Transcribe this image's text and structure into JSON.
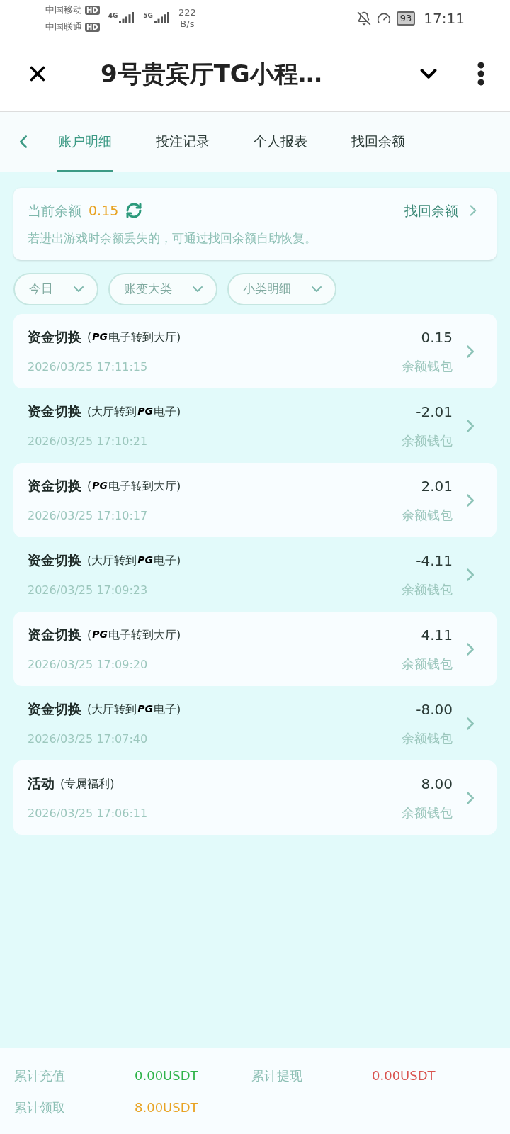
{
  "status_bar": {
    "carriers": [
      {
        "name": "中国移动",
        "badge": "HD"
      },
      {
        "name": "中国联通",
        "badge": "HD"
      }
    ],
    "networks": [
      "4G",
      "5G"
    ],
    "speed_value": "222",
    "speed_unit": "B/s",
    "battery": "93",
    "time": "17:11"
  },
  "header": {
    "title": "9号贵宾厅TG小程…"
  },
  "tabs": [
    {
      "label": "账户明细",
      "selected": true
    },
    {
      "label": "投注记录",
      "selected": false
    },
    {
      "label": "个人报表",
      "selected": false
    },
    {
      "label": "找回余额",
      "selected": false
    }
  ],
  "balance": {
    "label": "当前余额",
    "value": "0.15",
    "link": "找回余额",
    "hint": "若进出游戏时余额丢失的，可通过找回余额自助恢复。"
  },
  "filters": [
    "今日",
    "账变大类",
    "小类明细"
  ],
  "records": [
    {
      "title": "资金切换",
      "note_before": "(",
      "logo": "PG",
      "note_after": "电子转到大厅)",
      "time": "2026/03/25 17:11:15",
      "amount": "0.15",
      "wallet": "余额钱包"
    },
    {
      "title": "资金切换",
      "note_before": "(大厅转到",
      "logo": "PG",
      "note_after": "电子)",
      "time": "2026/03/25 17:10:21",
      "amount": "-2.01",
      "wallet": "余额钱包"
    },
    {
      "title": "资金切换",
      "note_before": "(",
      "logo": "PG",
      "note_after": "电子转到大厅)",
      "time": "2026/03/25 17:10:17",
      "amount": "2.01",
      "wallet": "余额钱包"
    },
    {
      "title": "资金切换",
      "note_before": "(大厅转到",
      "logo": "PG",
      "note_after": "电子)",
      "time": "2026/03/25 17:09:23",
      "amount": "-4.11",
      "wallet": "余额钱包"
    },
    {
      "title": "资金切换",
      "note_before": "(",
      "logo": "PG",
      "note_after": "电子转到大厅)",
      "time": "2026/03/25 17:09:20",
      "amount": "4.11",
      "wallet": "余额钱包"
    },
    {
      "title": "资金切换",
      "note_before": "(大厅转到",
      "logo": "PG",
      "note_after": "电子)",
      "time": "2026/03/25 17:07:40",
      "amount": "-8.00",
      "wallet": "余额钱包"
    },
    {
      "title": "活动",
      "note_before": "(专属福利)",
      "time": "2026/03/25 17:06:11",
      "amount": "8.00",
      "wallet": "余额钱包"
    }
  ],
  "summary": [
    {
      "label": "累计充值",
      "value": "0.00USDT",
      "color": "#2fb34a"
    },
    {
      "label": "累计提现",
      "value": "0.00USDT",
      "color": "#d9534f"
    },
    {
      "label": "累计领取",
      "value": "8.00USDT",
      "color": "#e8a323"
    }
  ]
}
